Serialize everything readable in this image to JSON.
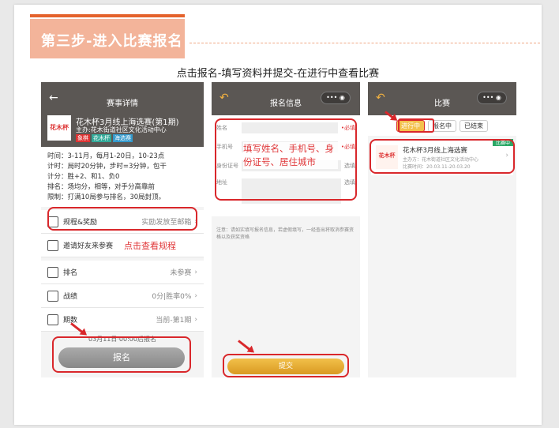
{
  "header": {
    "step_title": "第三步-进入比赛报名",
    "caption": "点击报名-填写资料并提交-在进行中查看比赛"
  },
  "phone1": {
    "nav_title": "赛事详情",
    "event_title": "花木杯3月线上海选赛(第1期)",
    "organizer": "主办:花木街道社区文化活动中心",
    "logo_text": "花木杯",
    "tags": [
      "象棋",
      "花木杯",
      "海选赛"
    ],
    "details": [
      "时间：3-11月，每月1-20日，10-23点",
      "计时：局时20分钟，步时=3分钟，包干",
      "计分：胜+2、和1、负0",
      "排名：场均分，相等，对手分高靠前",
      "限制：打满10局参与排名，30局封顶。"
    ],
    "rules_label": "规程&奖励",
    "rules_right": "实励发放至邮箱",
    "invite_label": "邀请好友来参赛",
    "invite_hint": "点击查看规程",
    "rank_label": "排名",
    "rank_value": "未参赛",
    "record_label": "战绩",
    "record_value": "0分|胜率0%",
    "period_label": "期数",
    "period_value": "当前-第1期",
    "deadline": "03月11日·00:00后报名",
    "signup_button": "报名"
  },
  "phone2": {
    "nav_title": "报名信息",
    "fields": [
      {
        "label": "姓名",
        "req": "•必填"
      },
      {
        "label": "手机号",
        "req": "•必填"
      },
      {
        "label": "身份证号",
        "req": "选填"
      },
      {
        "label": "地址",
        "req": "选填"
      }
    ],
    "overlay": "填写姓名、手机号、身份证号、居住城市",
    "notice": "注意：请如实填写报名信息，若虚假填写，一经查出将取消参赛资格以及获奖资格",
    "submit_button": "提交"
  },
  "phone3": {
    "nav_title": "比赛",
    "tabs": [
      "进行中",
      "报名中",
      "已结束"
    ],
    "card_badge": "比赛中",
    "card_title": "花木杯3月线上海选赛",
    "card_org": "主办方：花木街道社区文化活动中心",
    "card_time": "比赛时间：20.03.11-20.03.20",
    "logo_text": "花木杯"
  }
}
